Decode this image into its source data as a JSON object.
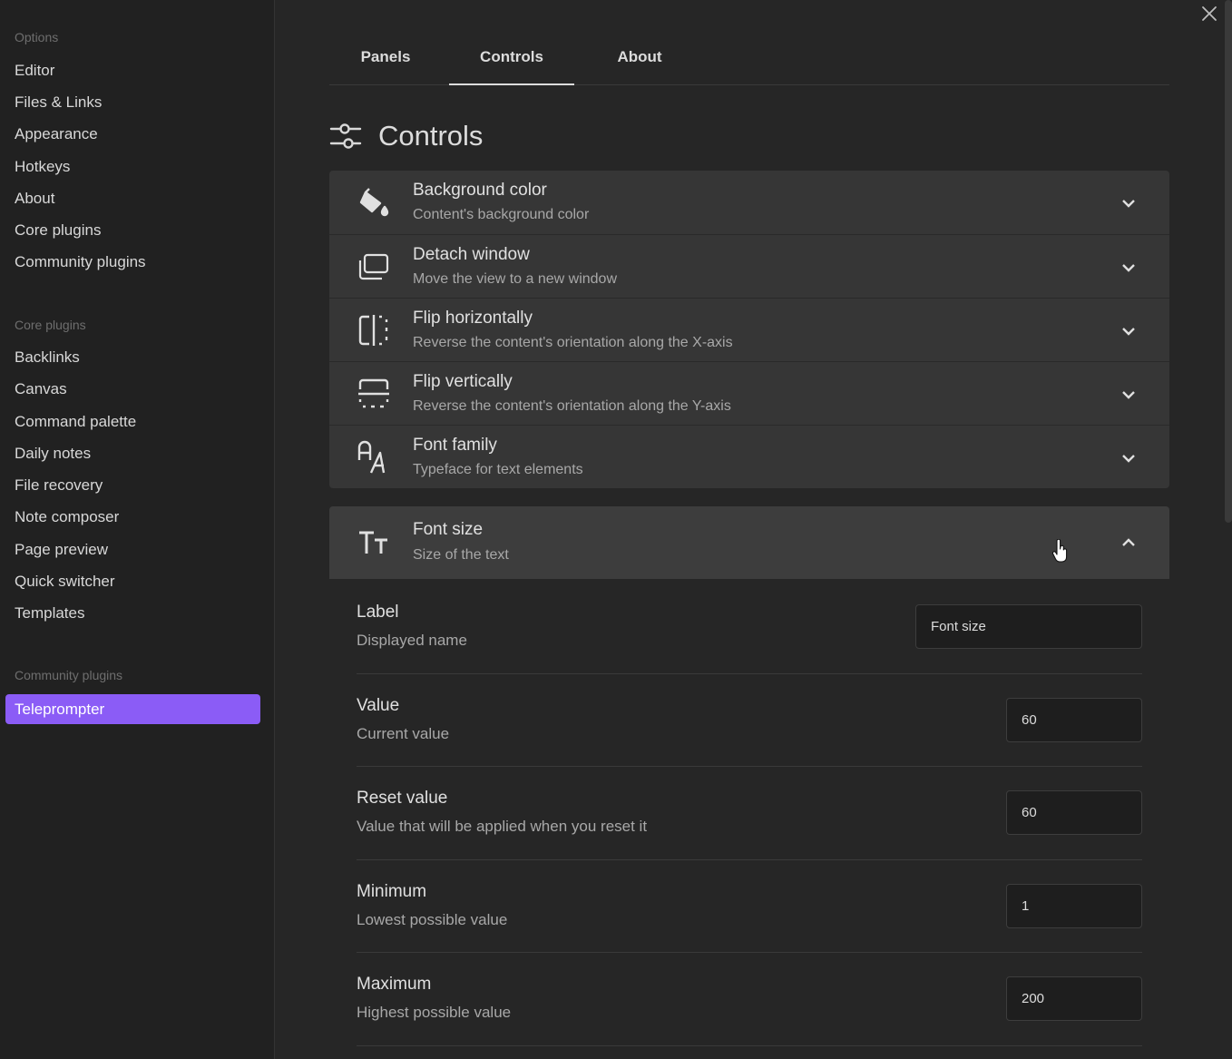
{
  "sidebar": {
    "options_header": "Options",
    "options": [
      "Editor",
      "Files & Links",
      "Appearance",
      "Hotkeys",
      "About",
      "Core plugins",
      "Community plugins"
    ],
    "core_header": "Core plugins",
    "core": [
      "Backlinks",
      "Canvas",
      "Command palette",
      "Daily notes",
      "File recovery",
      "Note composer",
      "Page preview",
      "Quick switcher",
      "Templates"
    ],
    "community_header": "Community plugins",
    "active_item": "Teleprompter"
  },
  "tabs": [
    "Panels",
    "Controls",
    "About"
  ],
  "active_tab": "Controls",
  "section_title": "Controls",
  "controls": [
    {
      "name": "Background color",
      "desc": "Content's background color",
      "icon": "paint-bucket-icon"
    },
    {
      "name": "Detach window",
      "desc": "Move the view to a new window",
      "icon": "picture-in-picture-icon"
    },
    {
      "name": "Flip horizontally",
      "desc": "Reverse the content's orientation along the X-axis",
      "icon": "flip-horizontal-icon"
    },
    {
      "name": "Flip vertically",
      "desc": "Reverse the content's orientation along the Y-axis",
      "icon": "flip-vertical-icon"
    },
    {
      "name": "Font family",
      "desc": "Typeface for text elements",
      "icon": "font-family-icon"
    }
  ],
  "expanded": {
    "name": "Font size",
    "desc": "Size of the text",
    "icon": "text-size-icon",
    "settings": [
      {
        "name": "Label",
        "desc": "Displayed name",
        "value": "Font size"
      },
      {
        "name": "Value",
        "desc": "Current value",
        "value": "60"
      },
      {
        "name": "Reset value",
        "desc": "Value that will be applied when you reset it",
        "value": "60"
      },
      {
        "name": "Minimum",
        "desc": "Lowest possible value",
        "value": "1"
      },
      {
        "name": "Maximum",
        "desc": "Highest possible value",
        "value": "200"
      }
    ]
  },
  "colors": {
    "accent": "#8b5cf6",
    "background": "#262626",
    "sidebar": "#212121",
    "panel": "#363636"
  }
}
